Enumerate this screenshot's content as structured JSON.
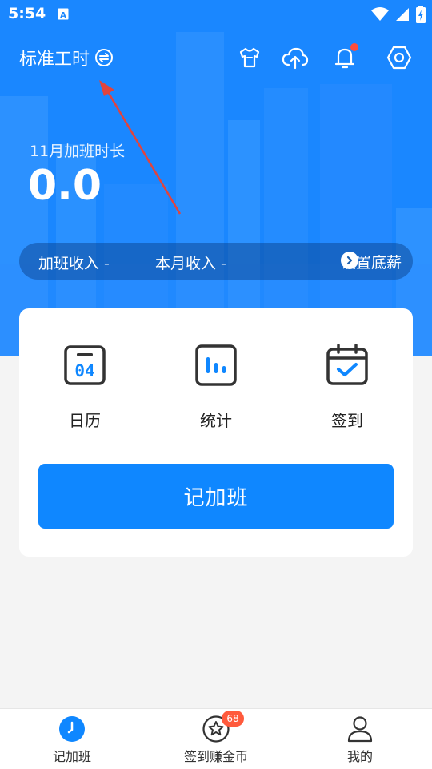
{
  "status_bar": {
    "time": "5:54"
  },
  "header": {
    "title": "标准工时"
  },
  "overtime": {
    "label": "11月加班时长",
    "value": "0.0"
  },
  "income": {
    "overtime_income": "加班收入 -",
    "monthly_income": "本月收入 -",
    "set_salary": "设置底薪"
  },
  "shortcuts": [
    {
      "label": "日历",
      "icon": "calendar-icon",
      "day": "04"
    },
    {
      "label": "统计",
      "icon": "statistics-icon"
    },
    {
      "label": "签到",
      "icon": "checkin-icon"
    }
  ],
  "record_button": "记加班",
  "tabs": [
    {
      "label": "记加班",
      "icon": "clock-icon",
      "active": true
    },
    {
      "label": "签到赚金币",
      "icon": "star-icon",
      "badge": "68"
    },
    {
      "label": "我的",
      "icon": "person-icon"
    }
  ],
  "colors": {
    "primary": "#1a87ff",
    "button": "#0f87ff",
    "badge": "#ff5a3c",
    "annotation_arrow": "#e0443e"
  }
}
